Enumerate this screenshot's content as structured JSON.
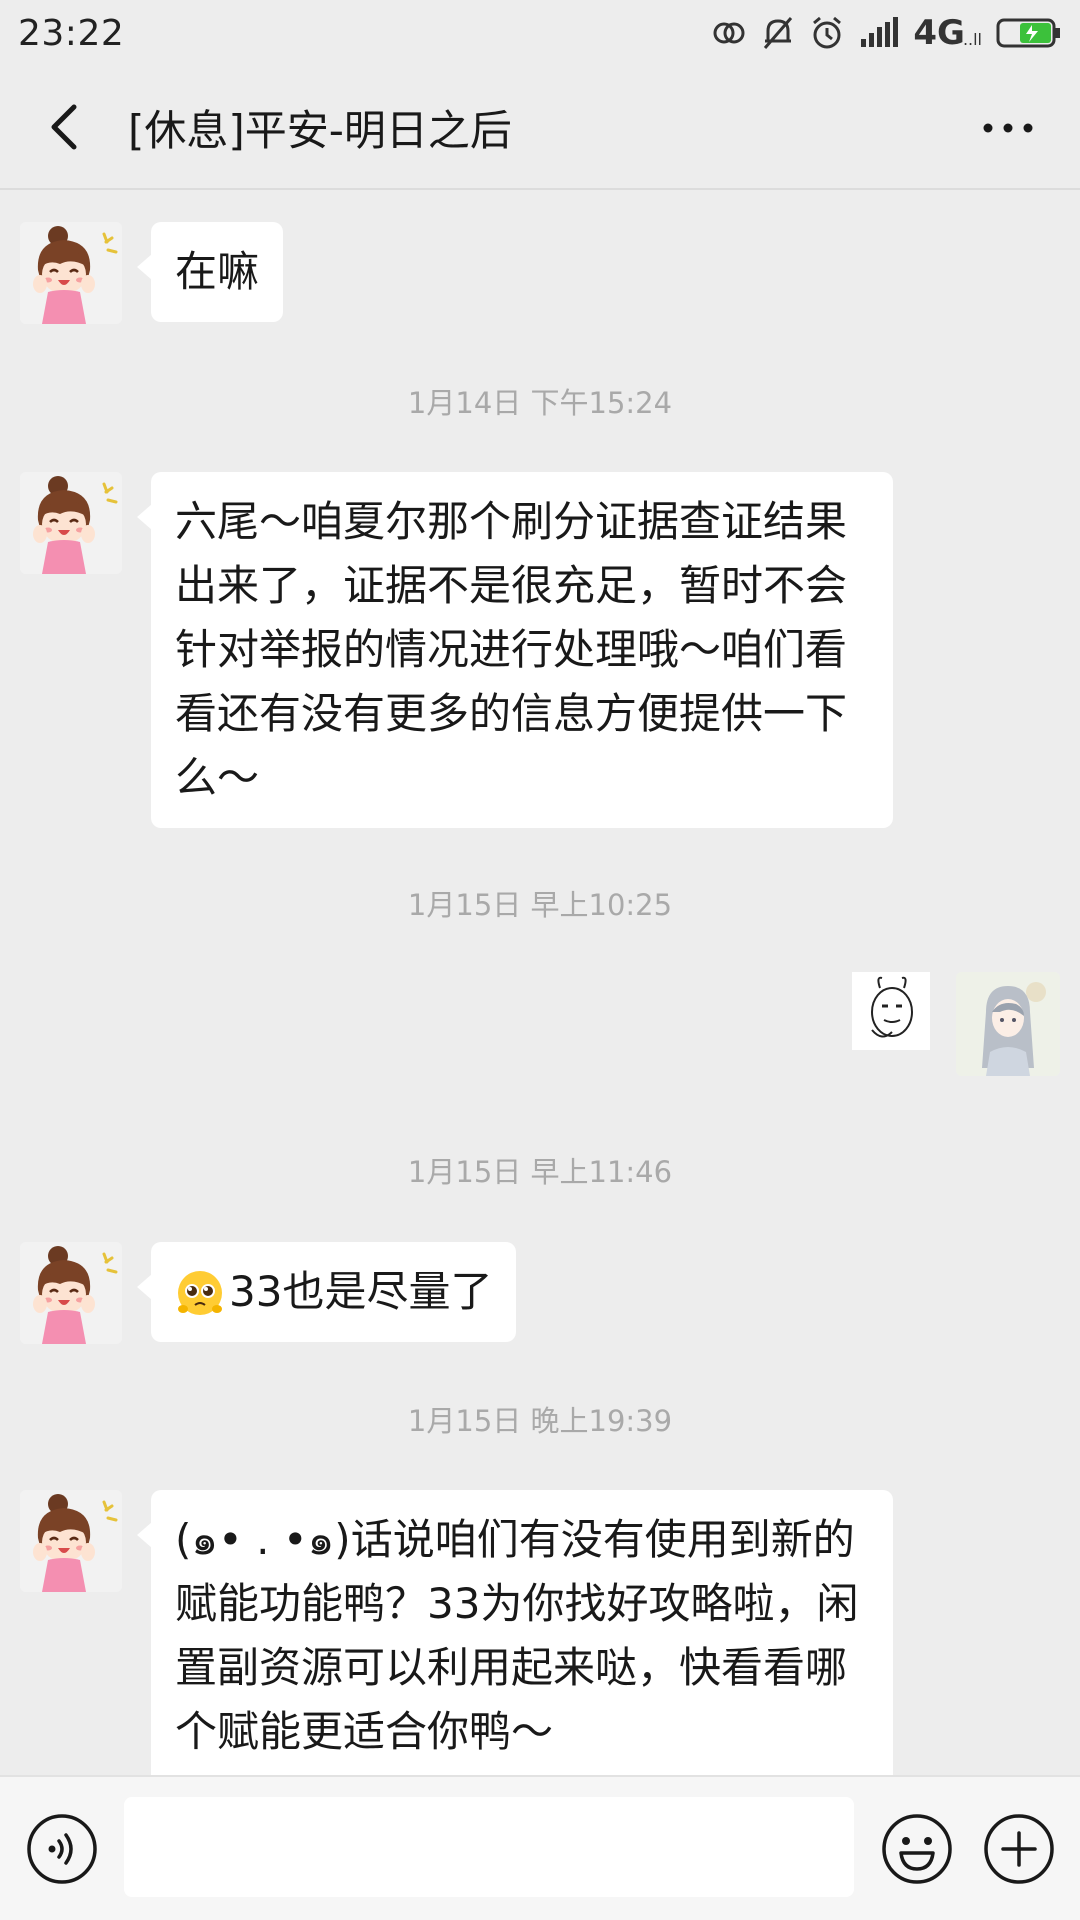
{
  "status_bar": {
    "time": "23:22",
    "network": "4G",
    "network_sub": "..ll",
    "icons": [
      "sync-icon",
      "mute-bell-icon",
      "alarm-icon",
      "signal-icon",
      "battery-charging-icon"
    ]
  },
  "header": {
    "title": "[休息]平安-明日之后",
    "back_icon": "chevron-left-icon",
    "more_icon": "more-dots-icon"
  },
  "messages": [
    {
      "type": "text",
      "side": "left",
      "text": "在嘛"
    },
    {
      "type": "time",
      "text": "1月14日 下午15:24"
    },
    {
      "type": "text",
      "side": "left",
      "lines": [
        "六尾～咱夏尔那个刷分证据查证结果",
        "出来了，证据不是很充足，暂时不会",
        "针对举报的情况进行处理哦～咱们看",
        "看还有没有更多的信息方便提供一下",
        "么～"
      ]
    },
    {
      "type": "time",
      "text": "1月15日 早上10:25"
    },
    {
      "type": "sticker",
      "side": "right"
    },
    {
      "type": "time",
      "text": "1月15日 早上11:46"
    },
    {
      "type": "text",
      "side": "left",
      "emoji": "pleading-face-emoji",
      "text": "33也是尽量了"
    },
    {
      "type": "time",
      "text": "1月15日 晚上19:39"
    },
    {
      "type": "text",
      "side": "left",
      "lines": [
        "(๑• . •๑)话说咱们有没有使用到新的",
        "赋能功能鸭？33为你找好攻略啦，闲",
        "置副资源可以利用起来哒，快看看哪",
        "个赋能更适合你鸭～"
      ]
    }
  ],
  "input_bar": {
    "placeholder": "",
    "voice_icon": "voice-icon",
    "emoji_icon": "emoji-face-icon",
    "plus_icon": "plus-circle-icon"
  },
  "colors": {
    "background": "#ededed",
    "bubble": "#ffffff",
    "timestamp": "#a9a9a9",
    "text": "#191919"
  }
}
